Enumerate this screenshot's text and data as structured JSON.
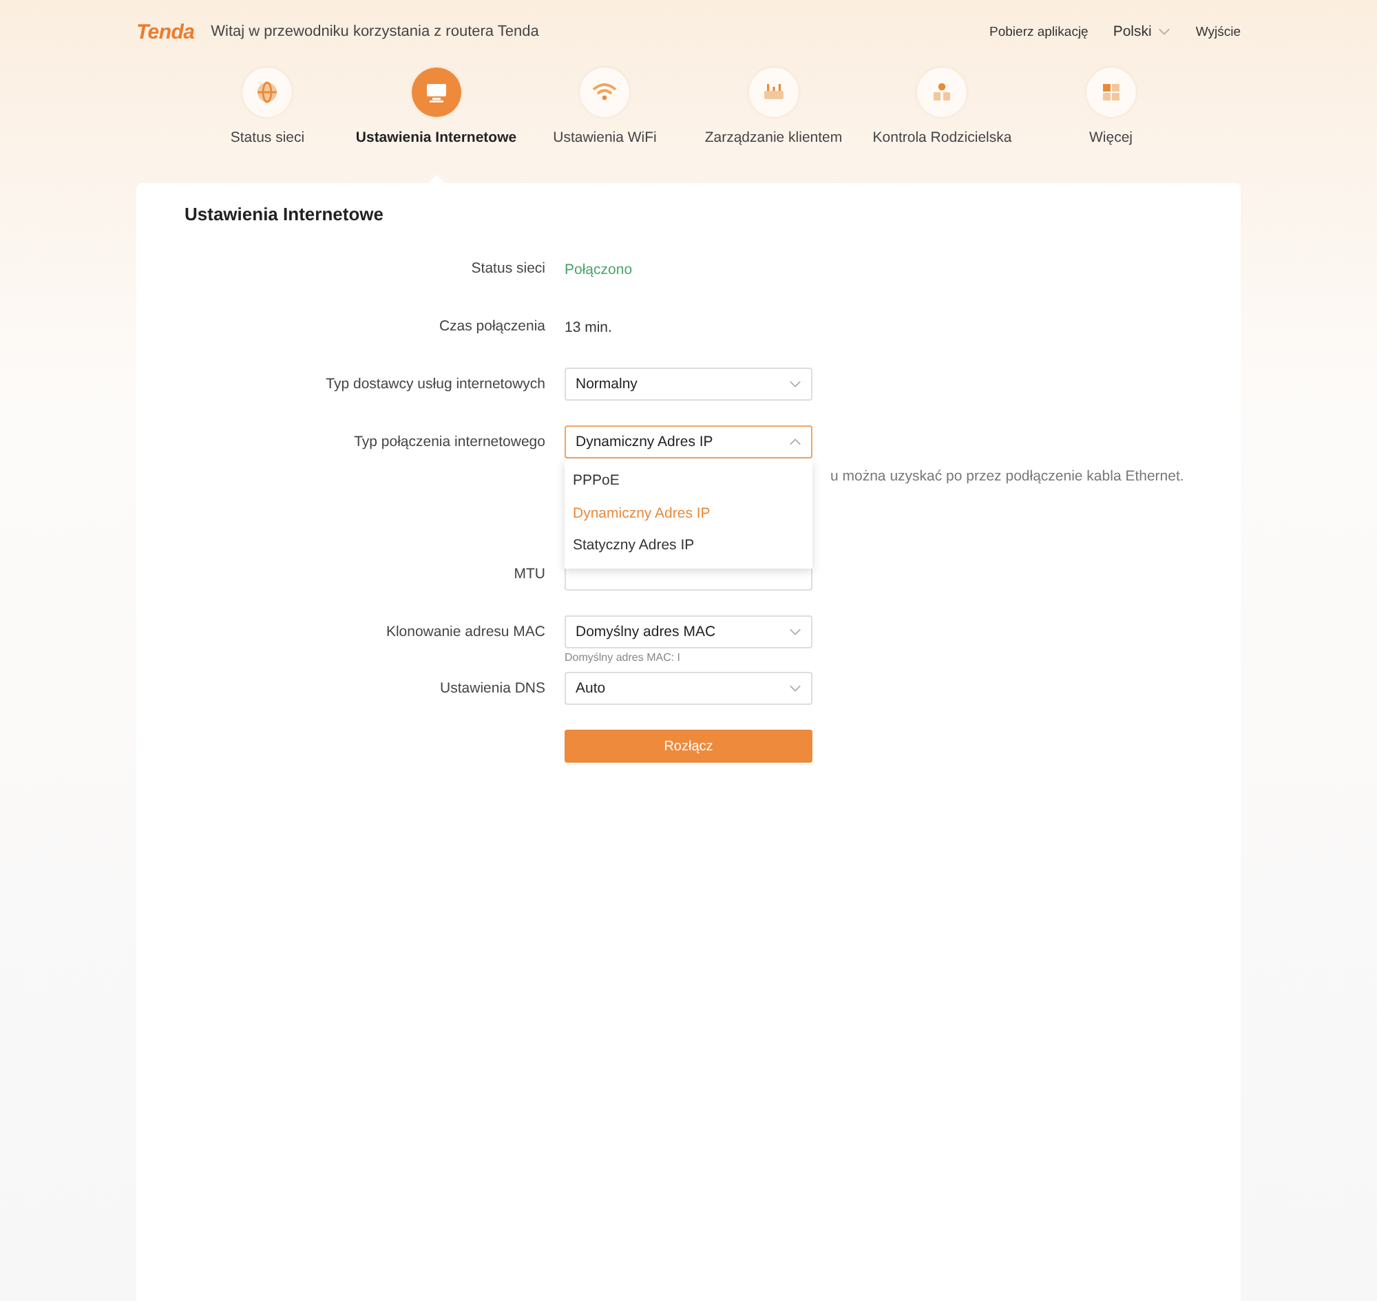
{
  "header": {
    "logo": "Tenda",
    "welcome": "Witaj w przewodniku korzystania z routera Tenda",
    "app_link": "Pobierz aplikację",
    "language": "Polski",
    "logout": "Wyjście"
  },
  "nav": [
    {
      "label": "Status sieci",
      "selected": false
    },
    {
      "label": "Ustawienia Internetowe",
      "selected": true
    },
    {
      "label": "Ustawienia WiFi",
      "selected": false
    },
    {
      "label": "Zarządzanie klientem",
      "selected": false
    },
    {
      "label": "Kontrola Rodzicielska",
      "selected": false
    },
    {
      "label": "Więcej",
      "selected": false
    }
  ],
  "page_title": "Ustawienia Internetowe",
  "fields": [
    {
      "kind": "status",
      "label": "Status sieci",
      "value": "Połączono"
    },
    {
      "kind": "text",
      "label": "Czas połączenia",
      "value": "13 min."
    },
    {
      "kind": "select",
      "label": "Typ dostawcy usług internetowych",
      "value": "Normalny",
      "expanded": false
    },
    {
      "kind": "select",
      "label": "Typ połączenia internetowego",
      "value": "Dynamiczny Adres IP",
      "expanded": true,
      "hint": "u można uzyskać po przez podłączenie kabla Ethernet.",
      "options": [
        {
          "label": "PPPoE",
          "selected": false
        },
        {
          "label": "Dynamiczny Adres IP",
          "selected": true
        },
        {
          "label": "Statyczny Adres IP",
          "selected": false
        }
      ]
    },
    {
      "kind": "input",
      "label": "MTU"
    },
    {
      "kind": "select",
      "label": "Klonowanie adresu MAC",
      "value": "Domyślny adres MAC",
      "expanded": false,
      "note": "Domyślny adres MAC: I"
    },
    {
      "kind": "select",
      "label": "Ustawienia DNS",
      "value": "Auto",
      "expanded": false
    }
  ],
  "button": "Rozłącz"
}
